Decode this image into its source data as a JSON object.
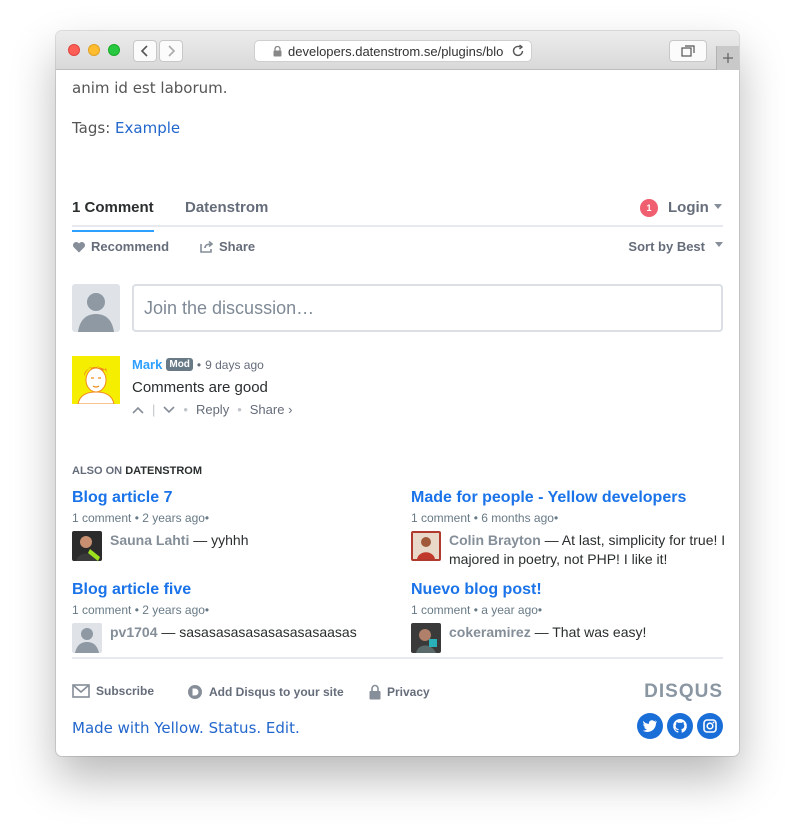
{
  "browser": {
    "url": "developers.datenstrom.se/plugins/blo"
  },
  "article": {
    "partial_line": "",
    "paragraph_end": "anim id est laborum.",
    "tags_label": "Tags:",
    "tag": "Example"
  },
  "disqus": {
    "tab_comments": "1 Comment",
    "tab_community": "Datenstrom",
    "notification_count": "1",
    "login": "Login",
    "recommend": "Recommend",
    "share": "Share",
    "sort": "Sort by Best",
    "join_placeholder": "Join the discussion…",
    "comment": {
      "author": "Mark",
      "badge": "Mod",
      "time": "9 days ago",
      "body": "Comments are good",
      "reply": "Reply",
      "share": "Share ›"
    },
    "also_on_prefix": "ALSO ON",
    "also_on_site": "DATENSTROM",
    "recommendations": [
      {
        "title": "Blog article 7",
        "meta": "1 comment • 2 years ago•",
        "user": "Sauna Lahti",
        "excerpt": " — yyhhh"
      },
      {
        "title": "Made for people - Yellow developers",
        "meta": "1 comment • 6 months ago•",
        "user": "Colin Brayton",
        "excerpt": " — At last, simplicity for true! I majored in poetry, not PHP! I like it!"
      },
      {
        "title": "Blog article five",
        "meta": "1 comment • 2 years ago•",
        "user": "pv1704",
        "excerpt": " — sasasasasasasasasasaasas"
      },
      {
        "title": "Nuevo blog post!",
        "meta": "1 comment • a year ago•",
        "user": "cokeramirez",
        "excerpt": " — That was easy!"
      }
    ],
    "footer": {
      "subscribe": "Subscribe",
      "add_disqus": "Add Disqus to your site",
      "privacy": "Privacy",
      "logo": "DISQUS"
    }
  },
  "site_footer": {
    "text": "Made with Yellow. Status. Edit."
  },
  "colors": {
    "accent": "#2e9fff",
    "link": "#1a73e8",
    "social": "#1a6ed8"
  }
}
